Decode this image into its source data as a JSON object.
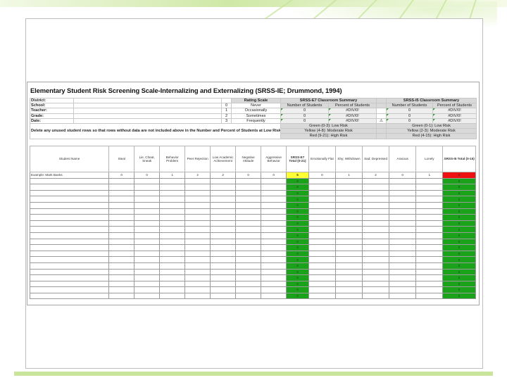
{
  "title": "Elementary Student Risk Screening Scale-Internalizing and Externalizing (SRSS-IE; Drummond, 1994)",
  "info": {
    "labels": [
      "District:",
      "School:",
      "Teacher:",
      "Grade:",
      "Date:"
    ],
    "rating_scale_title": "Rating Scale",
    "rating_scale": [
      {
        "value": "0",
        "label": "Never"
      },
      {
        "value": "1",
        "label": "Occasionally"
      },
      {
        "value": "2",
        "label": "Sometimes"
      },
      {
        "value": "3",
        "label": "Frequently"
      }
    ]
  },
  "summary_e7": {
    "title": "SRSS-E7 Classroom Summary",
    "col_number": "Number of Students",
    "col_percent": "Percent of Students",
    "numbers": [
      "0",
      "0",
      "0"
    ],
    "percents": [
      "#DIV/0!",
      "#DIV/0!",
      "#DIV/0!"
    ],
    "risk": [
      "Green (0-3): Low Risk",
      "Yellow (4-8): Moderate Risk",
      "Red (9-21): High Risk"
    ]
  },
  "summary_i5": {
    "title": "SRSS-I5 Classroom Summary",
    "col_number": "Number of Students",
    "col_percent": "Percent of Students",
    "numbers": [
      "0",
      "0",
      "0"
    ],
    "percents": [
      "#DIV/0!",
      "#DIV/0!",
      "#DIV/0!"
    ],
    "risk": [
      "Green (0-1): Low Risk",
      "Yellow (2-3): Moderate Risk",
      "Red (4-15): High Risk"
    ]
  },
  "note": "Delete any unused student rows so that rows without data are not included above in the Number and Percent of Students at Low Risk (due to default score of 0).",
  "warning_icon": "warning-icon",
  "columns": [
    "Student Name",
    "Steal",
    "Lie, Cheat, Sneak",
    "Behavior Problem",
    "Peer Rejection",
    "Low Academic Achievement",
    "Negative Attitude",
    "Aggressive Behavior",
    "SRSS-E7 Total (0-21)",
    "Emotionally Flat",
    "Shy; Withdrawn",
    "Sad; Depressed",
    "Anxious",
    "Lonely",
    "SRSS-I5 Total (0-15)"
  ],
  "example_row": [
    "Example: Mark Banks",
    "0",
    "0",
    "1",
    "2",
    "2",
    "0",
    "0",
    "5",
    "0",
    "1",
    "2",
    "0",
    "1",
    "4"
  ],
  "empty_score": "0",
  "colors": {
    "green": "#1aa31a",
    "yellow": "#ffff33",
    "red": "#ee1111",
    "header_gray": "#d9d9d9",
    "slide_accent": "#c9e59c"
  }
}
